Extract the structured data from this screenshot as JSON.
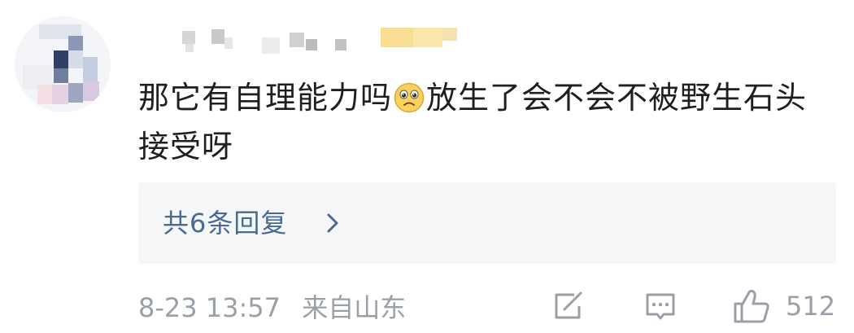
{
  "comment": {
    "text_before_emoji": "那它有自理能力吗",
    "emoji": "sad-face-emoji",
    "text_after_emoji": "放生了会不会不被野生石头接受呀"
  },
  "replies": {
    "label": "共6条回复",
    "chevron": "chevron-right-icon"
  },
  "meta": {
    "timestamp": "8-23 13:57",
    "location": "来自山东"
  },
  "actions": {
    "share_icon": "share-icon",
    "reply_icon": "comment-icon",
    "like_icon": "thumbs-up-icon",
    "like_count": "512"
  },
  "colors": {
    "link_blue": "#4b6a8f",
    "meta_gray": "#9aa0a8",
    "reply_bg": "#f5f6f8"
  }
}
